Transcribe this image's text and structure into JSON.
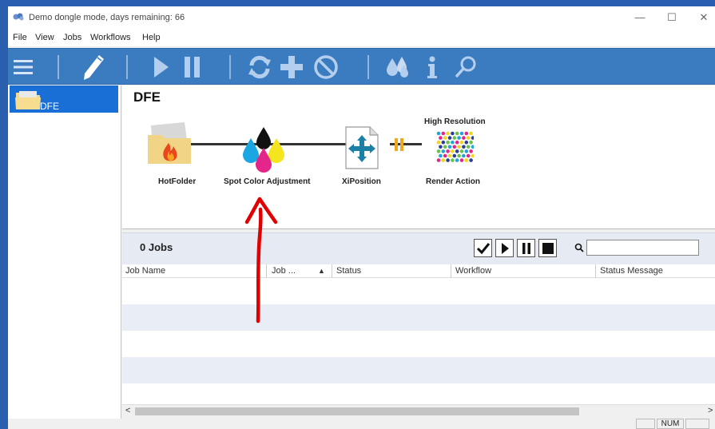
{
  "window": {
    "title": "Demo dongle mode, days remaining: 66",
    "minimize_glyph": "—",
    "maximize_glyph": "☐",
    "close_glyph": "✕"
  },
  "menu": [
    "File",
    "View",
    "Jobs",
    "Workflows",
    "Help"
  ],
  "toolbar": {
    "icons": [
      "menu-icon",
      "pencil-icon",
      "play-icon",
      "pause-icon",
      "sync-icon",
      "add-icon",
      "cancel-icon",
      "ink-drops-icon",
      "info-icon",
      "search-icon"
    ]
  },
  "sidebar": {
    "items": [
      {
        "label": "DFE",
        "icon": "folder-icon",
        "selected": true
      }
    ]
  },
  "workflow": {
    "title": "DFE",
    "nodes": [
      {
        "label": "HotFolder",
        "icon": "hotfolder-icon"
      },
      {
        "label": "Spot Color Adjustment",
        "icon": "cmyk-drops-icon"
      },
      {
        "label": "XiPosition",
        "icon": "move-arrows-icon"
      },
      {
        "label": "Render Action",
        "icon": "halftone-dots-icon",
        "top_label": "High Resolution"
      }
    ]
  },
  "jobs": {
    "count_label": "0 Jobs",
    "controls": [
      "check-icon",
      "play-icon",
      "pause-icon",
      "stop-icon"
    ],
    "search_value": "",
    "columns": [
      "Job Name",
      "Job ...",
      "Status",
      "Workflow",
      "Status Message"
    ],
    "sort_glyph": "▲",
    "rows": []
  },
  "scrollbar": {
    "left_glyph": "<",
    "right_glyph": ">"
  },
  "statusbar": {
    "num_label": "NUM"
  },
  "colors": {
    "toolbar": "#3b7bbf",
    "selection": "#1a6fd6",
    "annotation": "#e00000"
  }
}
